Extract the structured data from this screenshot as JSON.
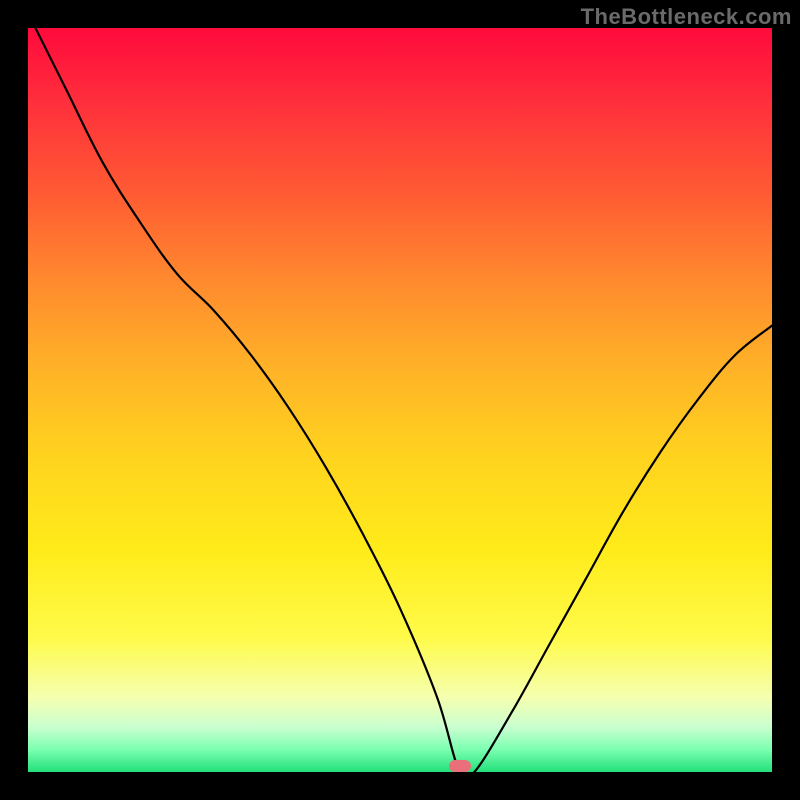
{
  "watermark": {
    "text": "TheBottleneck.com"
  },
  "marker": {
    "x_pct": 58,
    "y_pct": 99.2,
    "color": "#e9707a"
  },
  "chart_data": {
    "type": "line",
    "title": "",
    "xlabel": "",
    "ylabel": "",
    "xlim": [
      0,
      100
    ],
    "ylim": [
      0,
      100
    ],
    "grid": false,
    "legend": false,
    "x": [
      0,
      5,
      10,
      15,
      20,
      25,
      30,
      35,
      40,
      45,
      50,
      55,
      58,
      60,
      65,
      70,
      75,
      80,
      85,
      90,
      95,
      100
    ],
    "values": [
      102,
      92,
      82,
      74,
      67,
      62,
      56,
      49,
      41,
      32,
      22,
      10,
      0,
      0,
      8,
      17,
      26,
      35,
      43,
      50,
      56,
      60
    ],
    "series": [
      {
        "name": "bottleneck-curve",
        "x": [
          0,
          5,
          10,
          15,
          20,
          25,
          30,
          35,
          40,
          45,
          50,
          55,
          58,
          60,
          65,
          70,
          75,
          80,
          85,
          90,
          95,
          100
        ],
        "values": [
          102,
          92,
          82,
          74,
          67,
          62,
          56,
          49,
          41,
          32,
          22,
          10,
          0,
          0,
          8,
          17,
          26,
          35,
          43,
          50,
          56,
          60
        ]
      }
    ],
    "marker": {
      "x": 58,
      "y": 0
    },
    "gradient_stops": [
      {
        "pct": 0,
        "color": "#ff0a3c"
      },
      {
        "pct": 10,
        "color": "#ff2f3c"
      },
      {
        "pct": 22,
        "color": "#ff5a33"
      },
      {
        "pct": 34,
        "color": "#ff8a2e"
      },
      {
        "pct": 46,
        "color": "#ffb327"
      },
      {
        "pct": 58,
        "color": "#ffd41e"
      },
      {
        "pct": 70,
        "color": "#ffeb1a"
      },
      {
        "pct": 82,
        "color": "#fffb4a"
      },
      {
        "pct": 90,
        "color": "#f5ffb0"
      },
      {
        "pct": 94,
        "color": "#c9ffd0"
      },
      {
        "pct": 97,
        "color": "#7affb0"
      },
      {
        "pct": 100,
        "color": "#23e07a"
      }
    ]
  }
}
